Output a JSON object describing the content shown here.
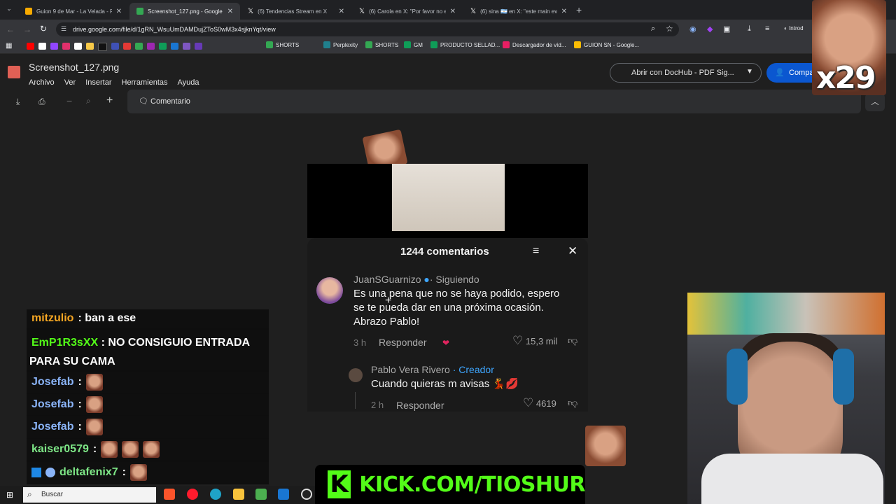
{
  "tabs": [
    {
      "title": "Guion 9 de Mar - La Velada - Pr",
      "color": "#f9ab00"
    },
    {
      "title": "Screenshot_127.png - Google D",
      "color": "#34a853"
    },
    {
      "title": "(6) Tendencias Stream en X",
      "color": "#ffffff"
    },
    {
      "title": "(6) Carola en X: \"Por favor no e",
      "color": "#ffffff"
    },
    {
      "title": "(6) sina 🇦🇷 en X: \"este main eve",
      "color": "#ffffff"
    }
  ],
  "address": "drive.google.com/file/d/1gRN_WsuUmDAMDujZToS0wM3x4sjknYqt/view",
  "profile_label": "Introd",
  "bookmarks": [
    {
      "label": "SHORTS",
      "color": "#34a853"
    },
    {
      "label": "Perplexity",
      "color": "#20808d"
    },
    {
      "label": "SHORTS",
      "color": "#34a853"
    },
    {
      "label": "GM",
      "color": "#0f9d58"
    },
    {
      "label": "PRODUCTO SELLAD...",
      "color": "#0f9d58"
    },
    {
      "label": "Descargador de víd...",
      "color": "#e91e63"
    },
    {
      "label": "GUION SN - Google...",
      "color": "#fbbc04"
    }
  ],
  "drive": {
    "filename": "Screenshot_127.png",
    "menu": [
      "Archivo",
      "Ver",
      "Insertar",
      "Herramientas",
      "Ayuda"
    ],
    "open_with": "Abrir con DocHub - PDF Sig...",
    "share": "Compar",
    "comment": "Comentario"
  },
  "comments_panel": {
    "count": "1244 comentarios",
    "c1": {
      "author": "JuanSGuarnizo",
      "following": "· Siguiendo",
      "text1": "Es una pena que no se haya podido, espero",
      "text2": "se te pueda dar en una próxima ocasión.",
      "text3": "Abrazo Pablo!",
      "time": "3 h",
      "reply": "Responder",
      "likes": "15,3 mil"
    },
    "c2": {
      "author": "Pablo Vera Rivero",
      "role": "· Creador",
      "text": "Cuando quieras m avisas 💃💋",
      "time": "2 h",
      "reply": "Responder",
      "likes": "4619"
    }
  },
  "chat": [
    {
      "user": "mitzulio",
      "color": "#f5a623",
      "msg": ": ban a ese"
    },
    {
      "user": "EmP1R3sXX",
      "color": "#53fc18",
      "msg": ": NO CONSIGUIO ENTRADA",
      "msg2": "PARA SU CAMA"
    },
    {
      "user": "Josefab",
      "color": "#8ab4f8",
      "msg": ":"
    },
    {
      "user": "Josefab",
      "color": "#8ab4f8",
      "msg": ":"
    },
    {
      "user": "Josefab",
      "color": "#8ab4f8",
      "msg": ":"
    },
    {
      "user": "kaiser0579",
      "color": "#7ee787",
      "msg": ":"
    },
    {
      "user": "deltafenix7",
      "color": "#7ee787",
      "msg": ":"
    }
  ],
  "kick_banner": "KICK.COM/TIOSHUR",
  "kick_logo": "K",
  "meme_count": "x29",
  "taskbar": {
    "search": "Buscar"
  }
}
